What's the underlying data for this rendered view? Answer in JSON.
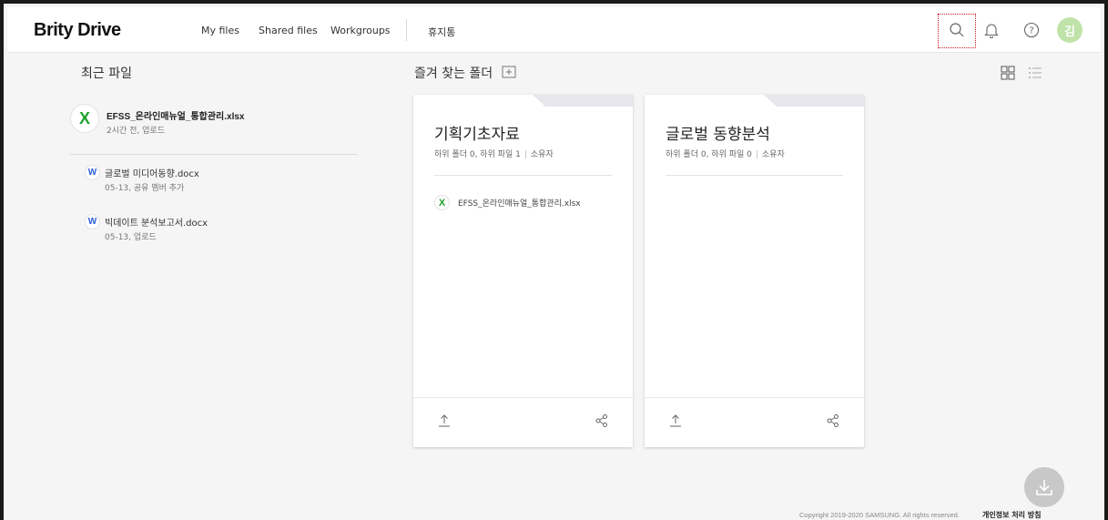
{
  "header": {
    "logo": "Brity Drive",
    "nav": [
      "My files",
      "Shared files",
      "Workgroups",
      "휴지통"
    ],
    "avatar_initial": "김",
    "icons": [
      "search-icon",
      "bell-icon",
      "help-icon"
    ]
  },
  "recent": {
    "title": "최근 파일",
    "main": {
      "name": "EFSS_온라인매뉴얼_통합관리.xlsx",
      "sub": "2시간 전, 업로드",
      "icon_letter": "X"
    },
    "items": [
      {
        "name": "글로벌 미디어동향.docx",
        "sub": "05-13, 공유 멤버 추가",
        "icon_letter": "W"
      },
      {
        "name": "빅데이트 분석보고서.docx",
        "sub": "05-13, 업로드",
        "icon_letter": "W"
      }
    ]
  },
  "favorites": {
    "title": "즐겨 찾는 폴더",
    "cards": [
      {
        "title": "기획기초자료",
        "meta": "하위 폴더 0, 하위 파일 1",
        "owner": "소유자",
        "file": "EFSS_온라인매뉴얼_통합관리.xlsx",
        "file_icon_letter": "X"
      },
      {
        "title": "글로벌 동향분석",
        "meta": "하위 폴더 0, 하위 파일 0",
        "owner": "소유자"
      }
    ]
  },
  "footer": {
    "copyright": "Copyright 2019-2020 SAMSUNG. All rights reserved.",
    "privacy": "개인정보 처리 방침"
  },
  "colors": {
    "excel": "#1fa12e",
    "word": "#2b5ed8",
    "avatar": "#bfe3a8",
    "focus_outline": "#d0161b"
  }
}
